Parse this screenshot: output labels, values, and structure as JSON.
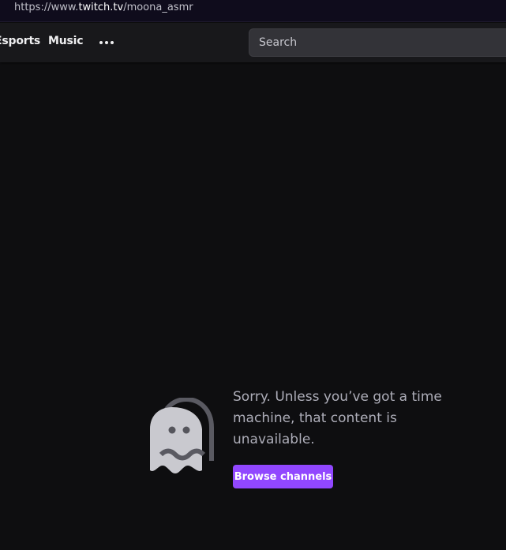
{
  "browser": {
    "url_prefix": "https://www.",
    "url_domain": "twitch.tv",
    "url_path": "/moona_asmr"
  },
  "nav": {
    "items": [
      {
        "label": "Esports"
      },
      {
        "label": "Music"
      }
    ],
    "more_icon": "ellipsis-icon"
  },
  "search": {
    "placeholder": "Search"
  },
  "error": {
    "icon": "ghost-icon",
    "line1": "Sorry. Unless you’ve got a time",
    "line2": "machine, that content is",
    "line3": "unavailable.",
    "button_label": "Browse channels"
  },
  "colors": {
    "background": "#0e0e10",
    "nav_background": "#18181b",
    "accent": "#9147ff",
    "text_muted": "#adadb8"
  }
}
